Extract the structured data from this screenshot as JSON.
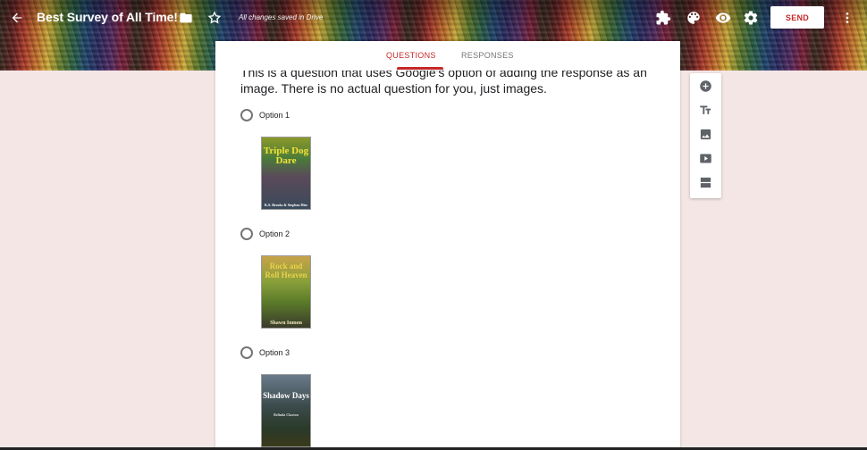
{
  "header": {
    "title": "Best Survey of All Time!",
    "saved_status": "All changes saved in Drive",
    "send_label": "SEND",
    "icons": [
      "back-arrow-icon",
      "folder-icon",
      "star-icon",
      "addon-puzzle-icon",
      "palette-icon",
      "preview-eye-icon",
      "settings-gear-icon",
      "more-vert-icon"
    ]
  },
  "tabs": [
    {
      "label": "QUESTIONS",
      "active": true
    },
    {
      "label": "RESPONSES",
      "active": false
    }
  ],
  "question": {
    "text": "This is a question that uses Google's option of adding the response as an image. There is no actual question for you, just images."
  },
  "options": [
    {
      "label": "Option 1",
      "cover_title": "Triple Dog Dare",
      "cover_author": "K.S. Brooks & Stephen Hise"
    },
    {
      "label": "Option 2",
      "cover_title": "Rock and Roll Heaven",
      "cover_author": "Shawn Inmon"
    },
    {
      "label": "Option 3",
      "cover_title": "Shadow Days",
      "cover_author": "Belinda Claxton"
    }
  ],
  "toolbar": {
    "items": [
      "add-question-icon",
      "add-title-icon",
      "add-image-icon",
      "add-video-icon",
      "add-section-icon"
    ]
  },
  "colors": {
    "accent": "#c62828",
    "background": "#f5e6e6"
  }
}
